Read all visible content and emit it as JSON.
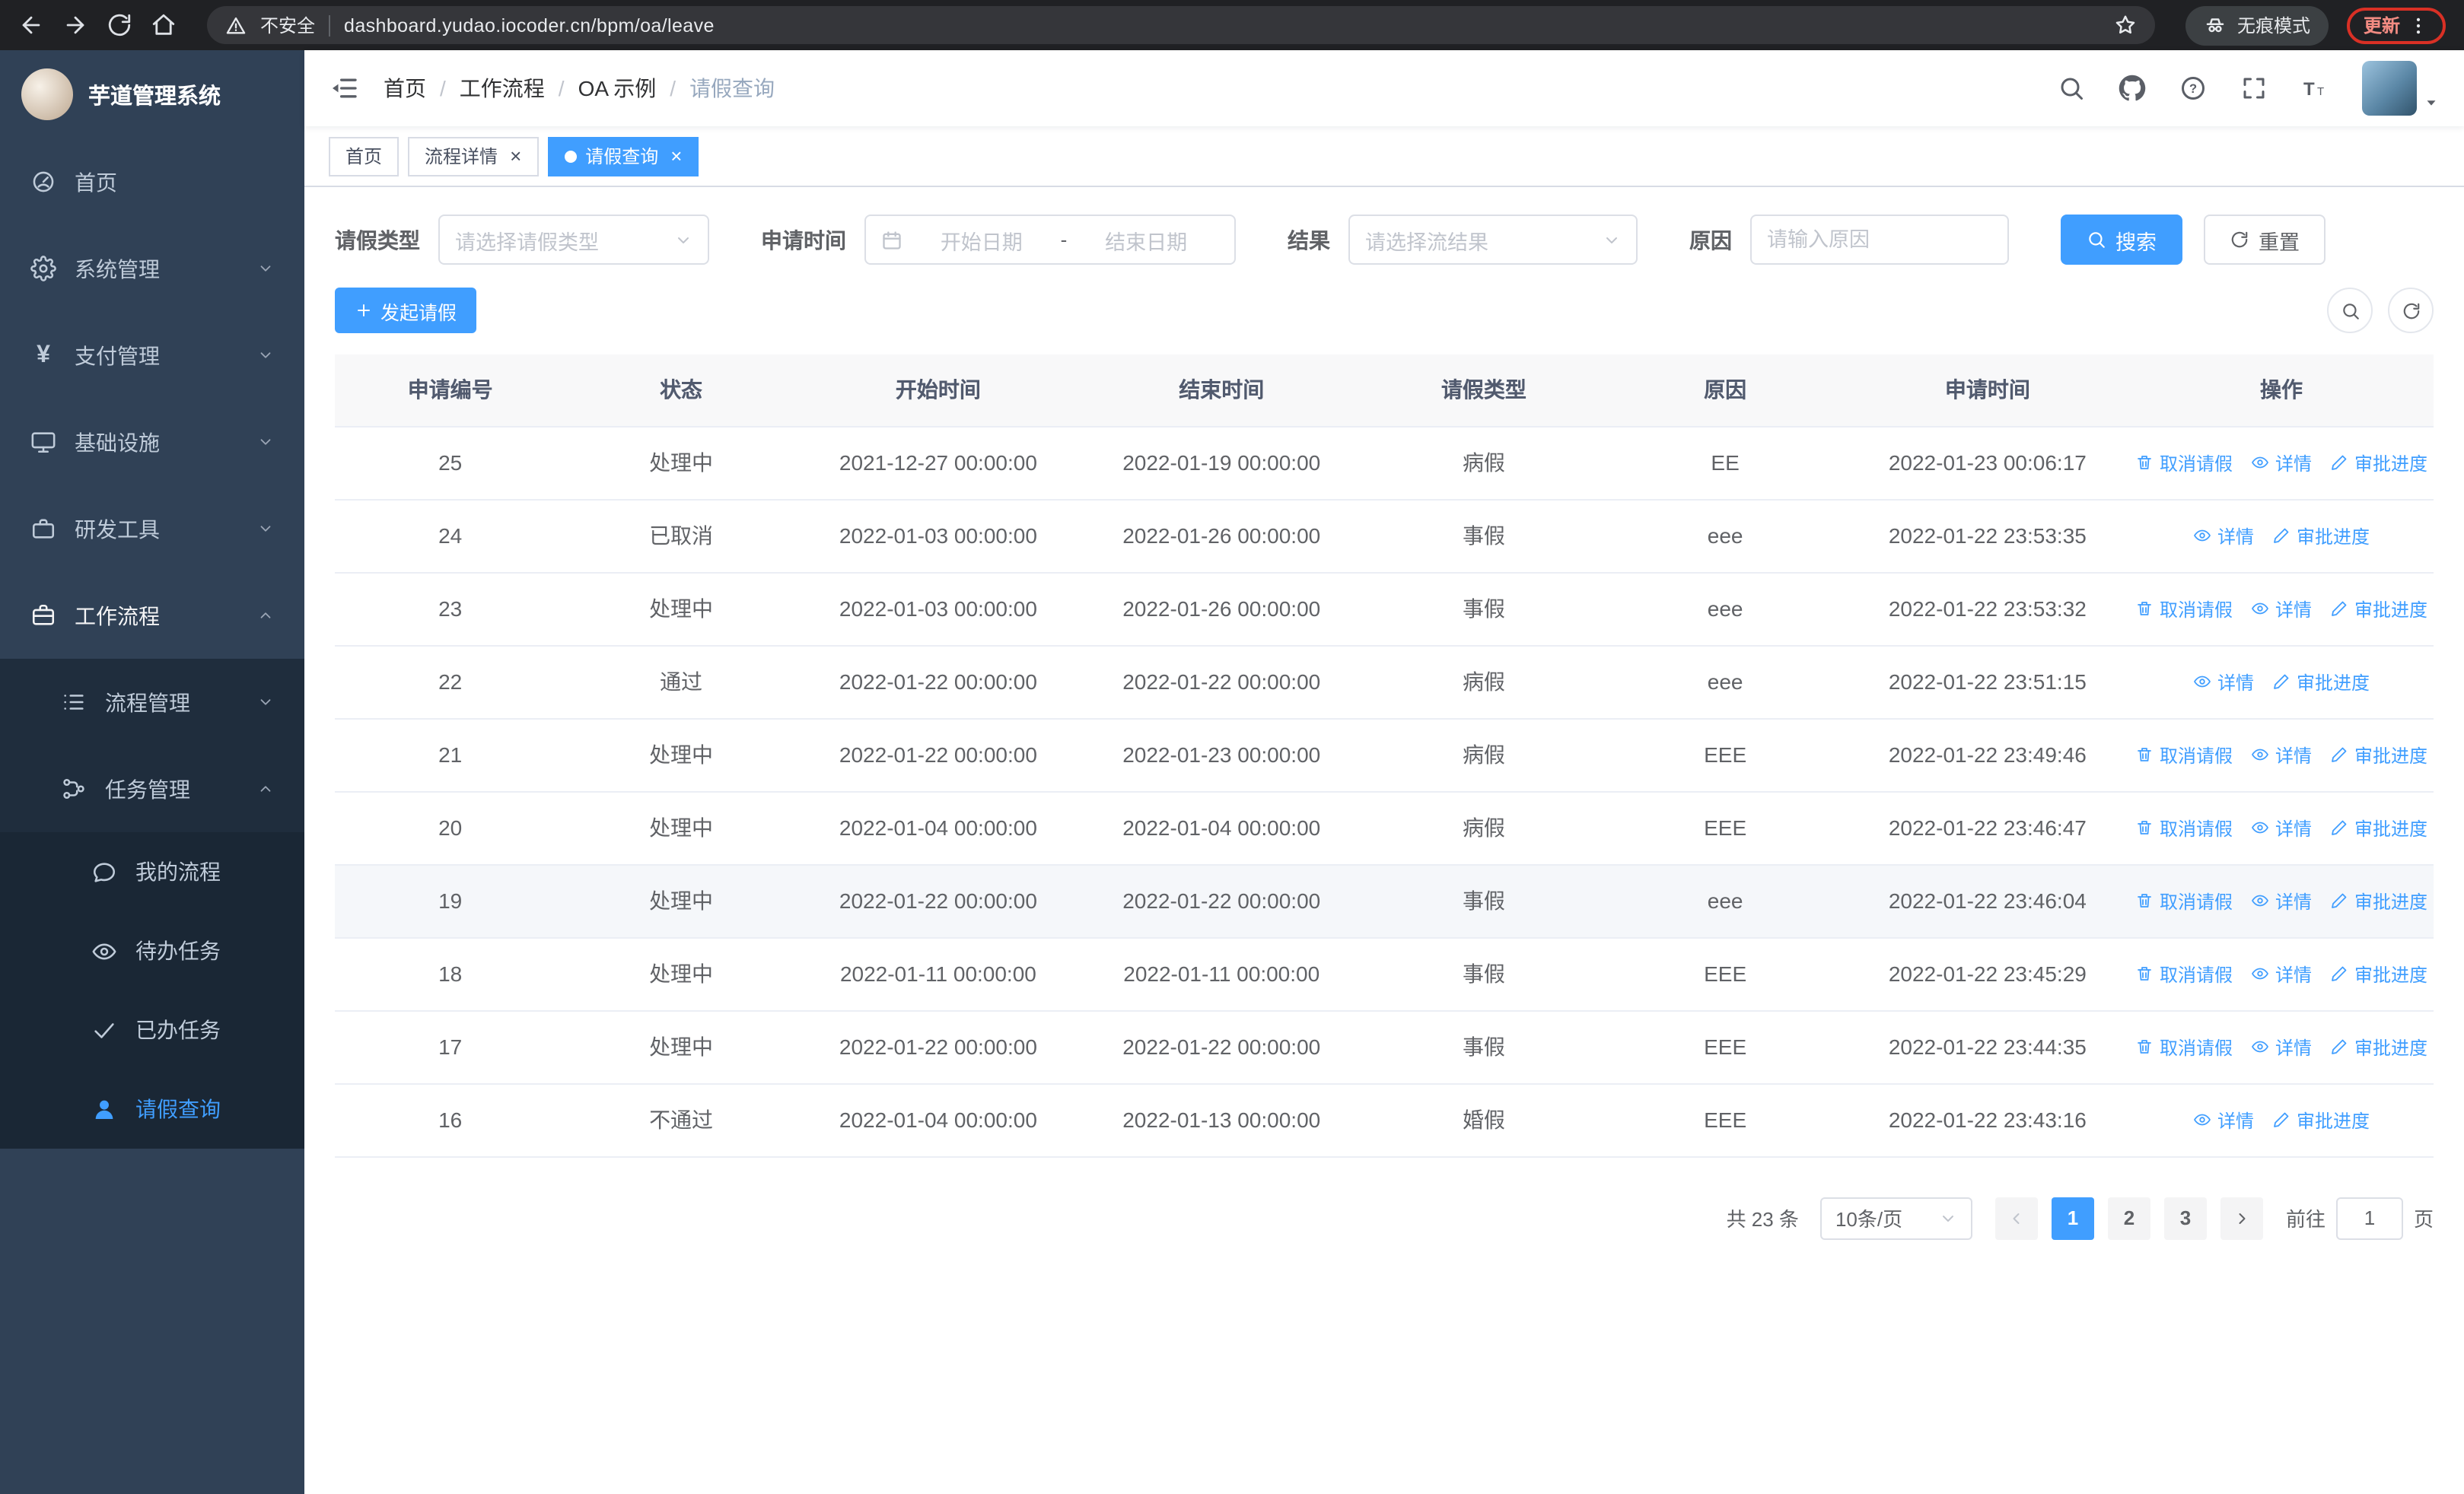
{
  "colors": {
    "accent": "#409eff",
    "sidebar_bg": "#304156",
    "sidebar_sub_bg": "#1f2d3d",
    "danger": "#d93025"
  },
  "browser": {
    "security_label": "不安全",
    "url": "dashboard.yudao.iocoder.cn/bpm/oa/leave",
    "incognito_label": "无痕模式",
    "update_label": "更新"
  },
  "sidebar": {
    "title": "芋道管理系统",
    "menu": {
      "home": "首页",
      "system": "系统管理",
      "payment": "支付管理",
      "infra": "基础设施",
      "devtools": "研发工具",
      "workflow": "工作流程",
      "process_mgmt": "流程管理",
      "task_mgmt": "任务管理",
      "my_process": "我的流程",
      "todo_tasks": "待办任务",
      "done_tasks": "已办任务",
      "leave_query": "请假查询"
    }
  },
  "breadcrumb": [
    "首页",
    "工作流程",
    "OA 示例",
    "请假查询"
  ],
  "tabs": [
    {
      "label": "首页"
    },
    {
      "label": "流程详情"
    },
    {
      "label": "请假查询"
    }
  ],
  "filters": {
    "leave_type_label": "请假类型",
    "leave_type_placeholder": "请选择请假类型",
    "apply_time_label": "申请时间",
    "start_placeholder": "开始日期",
    "range_separator": "-",
    "end_placeholder": "结束日期",
    "result_label": "结果",
    "result_placeholder": "请选择流结果",
    "reason_label": "原因",
    "reason_placeholder": "请输入原因",
    "search_label": "搜索",
    "reset_label": "重置"
  },
  "toolbar": {
    "create_label": "发起请假"
  },
  "table": {
    "columns": [
      "申请编号",
      "状态",
      "开始时间",
      "结束时间",
      "请假类型",
      "原因",
      "申请时间",
      "操作"
    ],
    "action_labels": {
      "cancel": "取消请假",
      "detail": "详情",
      "progress": "审批进度"
    },
    "rows": [
      {
        "id": "25",
        "status": "处理中",
        "start_time": "2021-12-27 00:00:00",
        "end_time": "2022-01-19 00:00:00",
        "leave_type": "病假",
        "reason": "EE",
        "apply_time": "2022-01-23 00:06:17",
        "actions": [
          "cancel",
          "detail",
          "progress"
        ]
      },
      {
        "id": "24",
        "status": "已取消",
        "start_time": "2022-01-03 00:00:00",
        "end_time": "2022-01-26 00:00:00",
        "leave_type": "事假",
        "reason": "eee",
        "apply_time": "2022-01-22 23:53:35",
        "actions": [
          "detail",
          "progress"
        ]
      },
      {
        "id": "23",
        "status": "处理中",
        "start_time": "2022-01-03 00:00:00",
        "end_time": "2022-01-26 00:00:00",
        "leave_type": "事假",
        "reason": "eee",
        "apply_time": "2022-01-22 23:53:32",
        "actions": [
          "cancel",
          "detail",
          "progress"
        ]
      },
      {
        "id": "22",
        "status": "通过",
        "start_time": "2022-01-22 00:00:00",
        "end_time": "2022-01-22 00:00:00",
        "leave_type": "病假",
        "reason": "eee",
        "apply_time": "2022-01-22 23:51:15",
        "actions": [
          "detail",
          "progress"
        ]
      },
      {
        "id": "21",
        "status": "处理中",
        "start_time": "2022-01-22 00:00:00",
        "end_time": "2022-01-23 00:00:00",
        "leave_type": "病假",
        "reason": "EEE",
        "apply_time": "2022-01-22 23:49:46",
        "actions": [
          "cancel",
          "detail",
          "progress"
        ]
      },
      {
        "id": "20",
        "status": "处理中",
        "start_time": "2022-01-04 00:00:00",
        "end_time": "2022-01-04 00:00:00",
        "leave_type": "病假",
        "reason": "EEE",
        "apply_time": "2022-01-22 23:46:47",
        "actions": [
          "cancel",
          "detail",
          "progress"
        ]
      },
      {
        "id": "19",
        "status": "处理中",
        "start_time": "2022-01-22 00:00:00",
        "end_time": "2022-01-22 00:00:00",
        "leave_type": "事假",
        "reason": "eee",
        "apply_time": "2022-01-22 23:46:04",
        "actions": [
          "cancel",
          "detail",
          "progress"
        ],
        "highlighted": true
      },
      {
        "id": "18",
        "status": "处理中",
        "start_time": "2022-01-11 00:00:00",
        "end_time": "2022-01-11 00:00:00",
        "leave_type": "事假",
        "reason": "EEE",
        "apply_time": "2022-01-22 23:45:29",
        "actions": [
          "cancel",
          "detail",
          "progress"
        ]
      },
      {
        "id": "17",
        "status": "处理中",
        "start_time": "2022-01-22 00:00:00",
        "end_time": "2022-01-22 00:00:00",
        "leave_type": "事假",
        "reason": "EEE",
        "apply_time": "2022-01-22 23:44:35",
        "actions": [
          "cancel",
          "detail",
          "progress"
        ]
      },
      {
        "id": "16",
        "status": "不通过",
        "start_time": "2022-01-04 00:00:00",
        "end_time": "2022-01-13 00:00:00",
        "leave_type": "婚假",
        "reason": "EEE",
        "apply_time": "2022-01-22 23:43:16",
        "actions": [
          "detail",
          "progress"
        ]
      }
    ]
  },
  "pagination": {
    "total_label": "共 23 条",
    "page_size_label": "10条/页",
    "pages": [
      "1",
      "2",
      "3"
    ],
    "active_page": "1",
    "goto_label": "前往",
    "goto_value": "1",
    "unit_label": "页"
  }
}
